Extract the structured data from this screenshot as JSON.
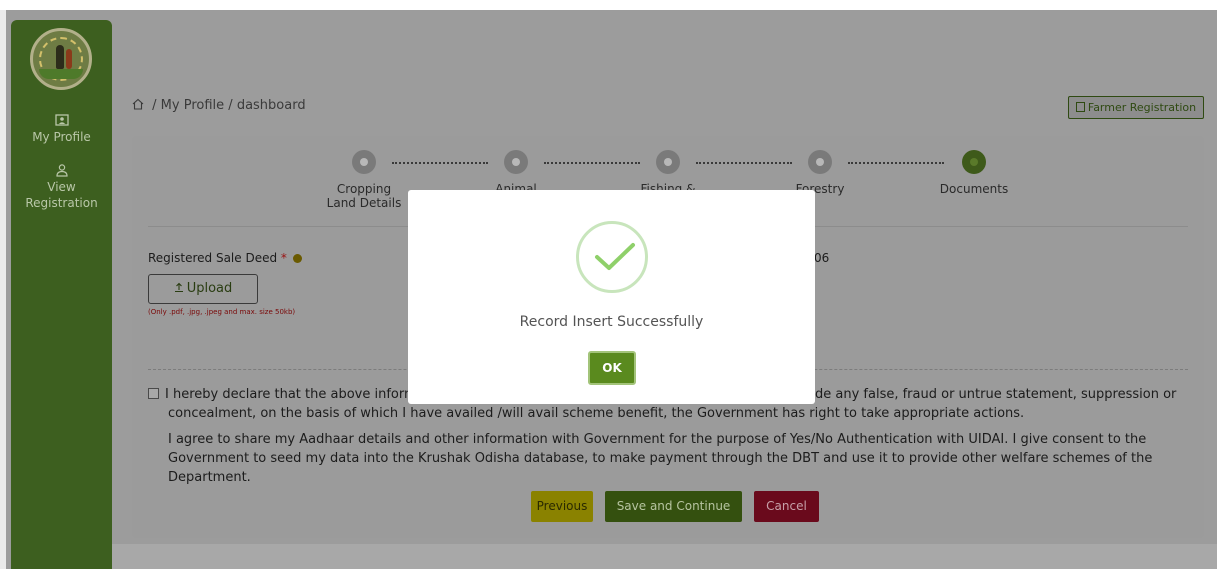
{
  "sidebar": {
    "items": [
      {
        "label": "My Profile",
        "icon": "profile-card-icon"
      },
      {
        "label_line1": "View",
        "label_line2": "Registration",
        "icon": "user-icon"
      }
    ]
  },
  "breadcrumb": {
    "separator": "/",
    "path1": "My Profile",
    "path2": "dashboard"
  },
  "header": {
    "farmer_registration_label": "Farmer Registration"
  },
  "steps": [
    {
      "line1": "Cropping",
      "line2": "Land Details"
    },
    {
      "line1": "Animal",
      "line2": ""
    },
    {
      "line1": "Fishing &",
      "line2": ""
    },
    {
      "line1": "Forestry",
      "line2": ""
    },
    {
      "line1": "Documents",
      "line2": ""
    }
  ],
  "form": {
    "sale_deed_label": "Registered Sale Deed",
    "required_mark": "*",
    "upload_label": "Upload",
    "upload_hint": "(Only .pdf, .jpg, .jpeg and max. size 50kb)",
    "right_value": "06"
  },
  "declaration": {
    "line1_left": "I hereby declare that the above inform",
    "line1_right": "de any false, fraud or untrue statement, suppression or",
    "line2": "concealment, on the basis of which I have availed /will avail scheme benefit, the Government has right to take appropriate actions."
  },
  "agreement": {
    "line1": "I agree to share my Aadhaar details and other information with Government for the purpose of Yes/No Authentication with UIDAI. I give consent to the",
    "line2": "Government to seed my data into the Krushak Odisha database, to make payment through the DBT and use it to provide other welfare schemes of the",
    "line3": "Department."
  },
  "actions": {
    "previous_label": "Previous",
    "save_label": "Save and Continue",
    "cancel_label": "Cancel"
  },
  "modal": {
    "message": "Record Insert Successfully",
    "ok_label": "OK"
  },
  "colors": {
    "sidebar": "#3d5f1f",
    "success": "#5a8a1e",
    "cancel": "#6a0a1c",
    "previous": "#8a8200"
  }
}
